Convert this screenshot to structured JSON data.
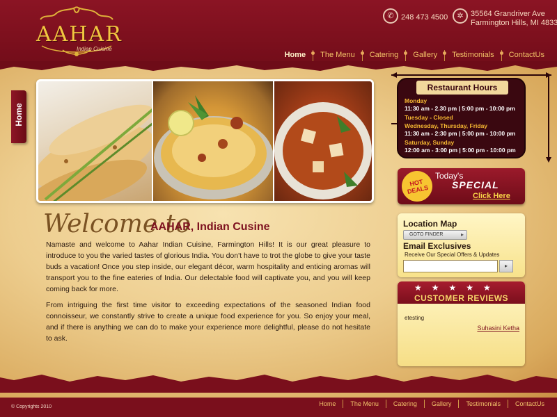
{
  "brand": {
    "name": "AAHAR",
    "tagline": "Indian Cuisine"
  },
  "contact": {
    "phone": "248 473 4500",
    "address_line1": "35564 Grandriver Ave",
    "address_line2": "Farmington Hills, MI 48335"
  },
  "nav": {
    "items": [
      {
        "label": "Home",
        "active": true
      },
      {
        "label": "The Menu"
      },
      {
        "label": "Catering"
      },
      {
        "label": "Gallery"
      },
      {
        "label": "Testimonials"
      },
      {
        "label": "ContactUs"
      }
    ]
  },
  "side_tab": {
    "label": "Home"
  },
  "welcome": {
    "script": "Welcome to",
    "name": "AAHAR, Indian Cusine",
    "paragraphs": [
      "Namaste and welcome to Aahar Indian Cuisine, Farmington Hills! It is our great pleasure to introduce to you the varied tastes of glorious India. You don't have to trot the globe to give your taste buds a vacation! Once you step inside, our elegant décor, warm hospitality and enticing aromas will transport you to the fine eateries of India. Our delectable food will captivate you, and you will keep coming back for more.",
      "From intriguing the first time visitor to exceeding expectations of the seasoned Indian food connoisseur, we constantly strive to create a unique food experience for you. So enjoy your meal, and if there is anything we can do to make your experience more delightful, please do not hesitate to ask."
    ]
  },
  "hours": {
    "title": "Restaurant Hours",
    "rows": [
      {
        "day": "Monday",
        "time": "11:30 am - 2.30 pm  |  5:00 pm - 10:00 pm"
      },
      {
        "day": "Tuesday - Closed",
        "time": ""
      },
      {
        "day": "Wednesday, Thursday, Friday",
        "time": "11:30 am - 2:30 pm  |  5:00 pm - 10:00 pm"
      },
      {
        "day": "Saturday, Sunday",
        "time": "12:00 am - 3:00 pm  |  5:00 pm - 10:00 pm"
      }
    ]
  },
  "special": {
    "badge_line1": "HOT",
    "badge_line2": "DEALS",
    "label": "Today's",
    "big": "SPECIAL",
    "link": "Click Here"
  },
  "location": {
    "title": "Location Map",
    "button": "GOTO FINDER"
  },
  "email": {
    "title": "Email Exclusives",
    "subtitle": "Receive Our Special Offers & Updates",
    "value": "",
    "go": "▸"
  },
  "reviews": {
    "stars": "★★★★★",
    "title": "CUSTOMER REVIEWS",
    "text": "etesting",
    "author": "Suhasini Ketha"
  },
  "footer": {
    "copyright": "© Copyrights 2010",
    "links": [
      "Home",
      "The Menu",
      "Catering",
      "Gallery",
      "Testimonials",
      "ContactUs"
    ]
  },
  "colors": {
    "maroon": "#7a0f1c",
    "gold": "#f2c640",
    "parchment": "#edcd8e"
  }
}
